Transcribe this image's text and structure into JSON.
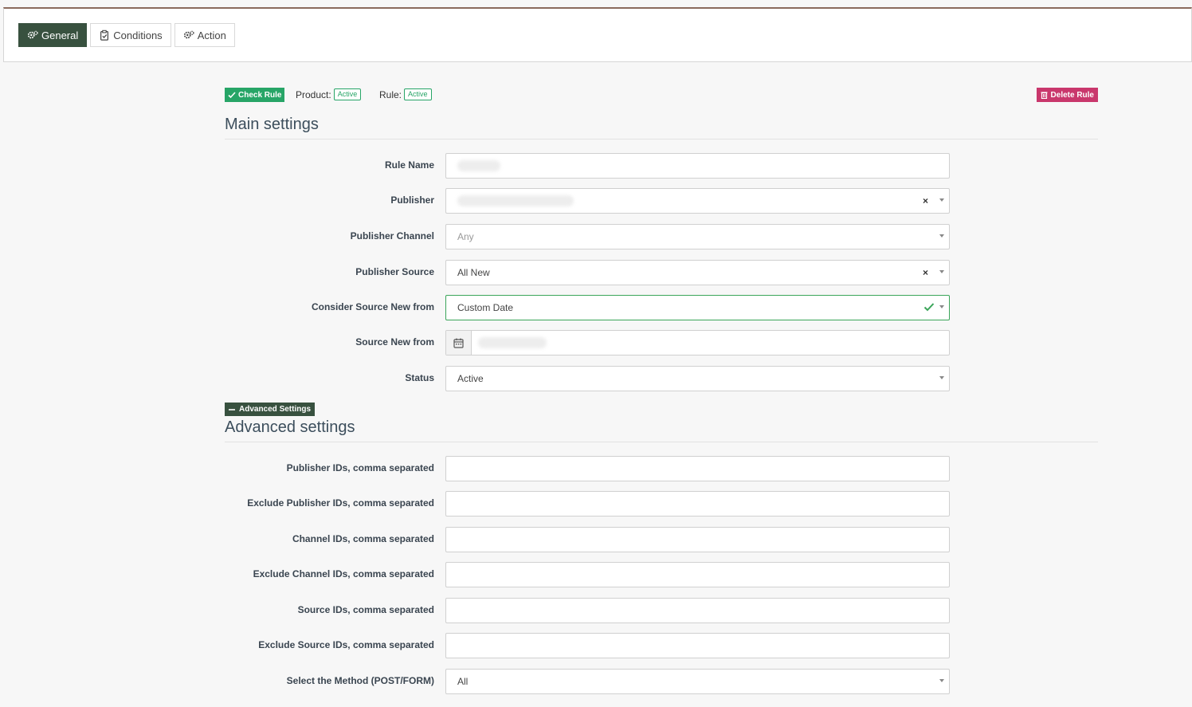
{
  "tabs": [
    {
      "label": "General",
      "icon": "gears-icon",
      "active": true
    },
    {
      "label": "Conditions",
      "icon": "clipboard-check-icon",
      "active": false
    },
    {
      "label": "Action",
      "icon": "gears-icon",
      "active": false
    }
  ],
  "status": {
    "check_rule_label": "Check Rule",
    "product_label": "Product:",
    "product_status": "Active",
    "rule_label": "Rule:",
    "rule_status": "Active",
    "delete_rule_label": "Delete Rule"
  },
  "main_settings": {
    "title": "Main settings",
    "rule_name": {
      "label": "Rule Name",
      "value": ""
    },
    "publisher": {
      "label": "Publisher",
      "value": ""
    },
    "publisher_channel": {
      "label": "Publisher Channel",
      "value": "Any"
    },
    "publisher_source": {
      "label": "Publisher Source",
      "value": "All New"
    },
    "consider_source": {
      "label": "Consider Source New from",
      "value": "Custom Date"
    },
    "source_new_from": {
      "label": "Source New from",
      "value": ""
    },
    "status": {
      "label": "Status",
      "value": "Active"
    }
  },
  "advanced_toggle_label": "Advanced Settings",
  "advanced_settings": {
    "title": "Advanced settings",
    "publisher_ids": {
      "label": "Publisher IDs, comma separated",
      "value": ""
    },
    "exclude_publisher_ids": {
      "label": "Exclude Publisher IDs, comma separated",
      "value": ""
    },
    "channel_ids": {
      "label": "Channel IDs, comma separated",
      "value": ""
    },
    "exclude_channel_ids": {
      "label": "Exclude Channel IDs, comma separated",
      "value": ""
    },
    "source_ids": {
      "label": "Source IDs, comma separated",
      "value": ""
    },
    "exclude_source_ids": {
      "label": "Exclude Source IDs, comma separated",
      "value": ""
    },
    "method": {
      "label": "Select the Method (POST/FORM)",
      "value": "All"
    }
  },
  "colors": {
    "tab_active": "#38513f",
    "success": "#27a567",
    "danger": "#c9376c"
  }
}
